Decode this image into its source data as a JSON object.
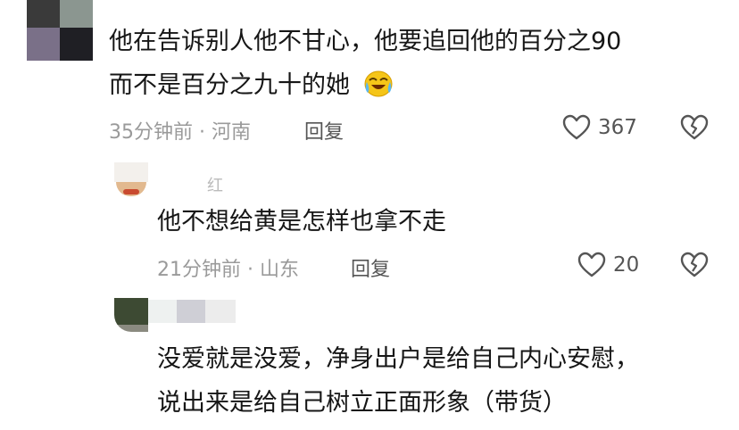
{
  "comments": [
    {
      "text_line1": "他在告诉别人他不甘心，他要追回他的百分之90",
      "text_line2": "而不是百分之九十的她",
      "emoji_icon": "laughing-crying-emoji",
      "time_location": "35分钟前 · 河南",
      "reply_label": "回复",
      "like_count": "367"
    },
    {
      "username": "红",
      "text_line1": "他不想给黄是怎样也拿不走",
      "time_location": "21分钟前 · 山东",
      "reply_label": "回复",
      "like_count": "20"
    },
    {
      "text_line1": "没爱就是没爱，净身出户是给自己内心安慰，",
      "text_line2": "说出来是给自己树立正面形象（带货）"
    }
  ],
  "colors": {
    "text": "#161616",
    "meta": "#9a9a9a",
    "icon": "#555555"
  }
}
